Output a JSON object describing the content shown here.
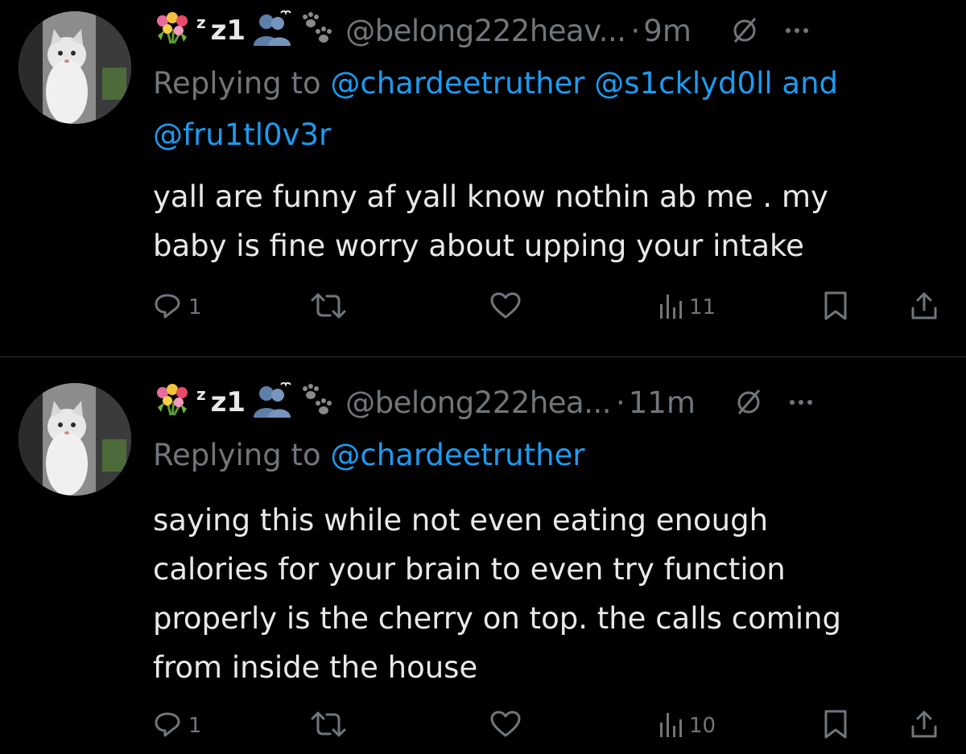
{
  "colors": {
    "background": "#000000",
    "text": "#e7e9ea",
    "secondary": "#71767b",
    "link": "#1d9bf0",
    "divider": "#2f3336"
  },
  "posts": [
    {
      "display_name_sup": "z",
      "display_name": "z1",
      "handle": "@belong222heav...",
      "separator": "·",
      "time": "9m",
      "reply_prefix": "Replying to",
      "mentions": [
        "@chardeetruther",
        "@s1cklyd0ll",
        "@fru1tl0v3r"
      ],
      "mention_joiner": "and",
      "text_lines": [
        "yall are funny af yall know nothin ab me . my",
        "baby is fine worry about upping your intake"
      ],
      "reply_count": "1",
      "view_count": "11",
      "icons": [
        "flower-bouquet-icon",
        "people-silhouette-icon",
        "paw-prints-icon",
        "grok-icon",
        "more-icon",
        "reply-icon",
        "retweet-icon",
        "like-icon",
        "views-icon",
        "bookmark-icon",
        "share-icon"
      ]
    },
    {
      "display_name_sup": "z",
      "display_name": "z1",
      "handle": "@belong222hea...",
      "separator": "·",
      "time": "11m",
      "reply_prefix": "Replying to",
      "mentions": [
        "@chardeetruther"
      ],
      "text_lines": [
        "saying this while not even eating enough",
        "calories for your brain to even try function",
        "properly is the cherry on top. the calls coming",
        "from inside the house"
      ],
      "reply_count": "1",
      "view_count": "10",
      "icons": [
        "flower-bouquet-icon",
        "people-silhouette-icon",
        "paw-prints-icon",
        "grok-icon",
        "more-icon",
        "reply-icon",
        "retweet-icon",
        "like-icon",
        "views-icon",
        "bookmark-icon",
        "share-icon"
      ]
    }
  ]
}
